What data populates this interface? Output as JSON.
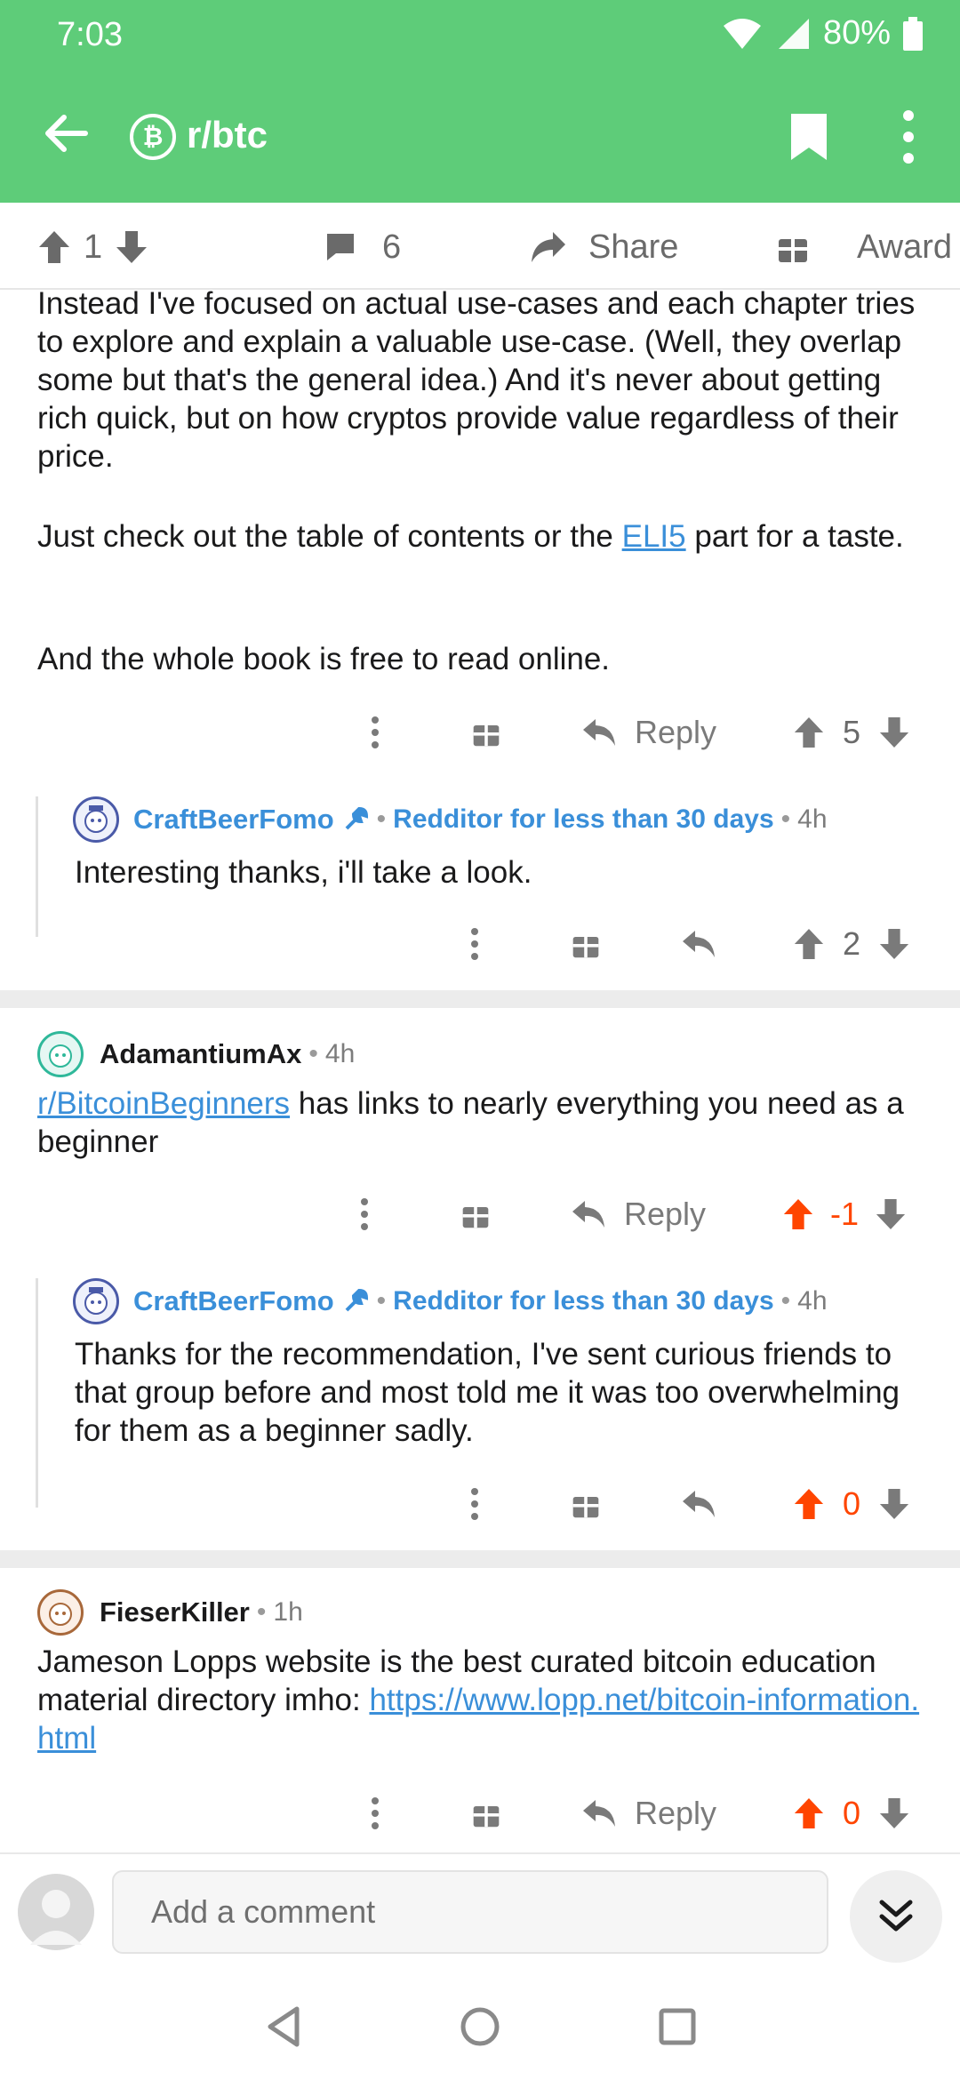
{
  "status": {
    "time": "7:03",
    "battery": "80%"
  },
  "appbar": {
    "title": "r/btc",
    "subreddit_icon": "bitcoin-icon"
  },
  "post_bar": {
    "score": "1",
    "comments": "6",
    "share": "Share",
    "award": "Award"
  },
  "top_comment": {
    "paragraph1": "Instead I've focused on actual use-cases and each chapter tries to explore and explain a valuable use-case. (Well, they overlap some but that's the general idea.) And it's never about getting rich quick, but on how cryptos provide value regardless of their price.",
    "paragraph2_before": "Just check out the table of contents or the ",
    "paragraph2_link": "ELI5",
    "paragraph2_after": " part for a taste.",
    "paragraph3": "And the whole book is free to read online.",
    "reply_label": "Reply",
    "score": "5"
  },
  "reply1": {
    "author": "CraftBeerFomo",
    "flair": "Redditor for less than 30 days",
    "age": "4h",
    "text": "Interesting thanks, i'll take a look.",
    "score": "2"
  },
  "comment2": {
    "author": "AdamantiumAx",
    "age": "4h",
    "link": "r/BitcoinBeginners",
    "text_after": " has links to nearly everything you need as a beginner",
    "reply_label": "Reply",
    "score": "-1"
  },
  "reply2": {
    "author": "CraftBeerFomo",
    "flair": "Redditor for less than 30 days",
    "age": "4h",
    "text": "Thanks for the recommendation, I've sent curious friends to that group before and most told me it was too overwhelming for them as a beginner sadly.",
    "score": "0"
  },
  "comment3": {
    "author": "FieserKiller",
    "age": "1h",
    "text_before": "Jameson Lopps website is the best curated bitcoin education material directory imho: ",
    "link": "https://www.lopp.net/bitcoin-information.html",
    "reply_label": "Reply",
    "score": "0"
  },
  "composer": {
    "placeholder": "Add a comment"
  },
  "colors": {
    "appbar": "#5ecc79",
    "upvote": "#ff4500",
    "link": "#3a8fd9"
  }
}
